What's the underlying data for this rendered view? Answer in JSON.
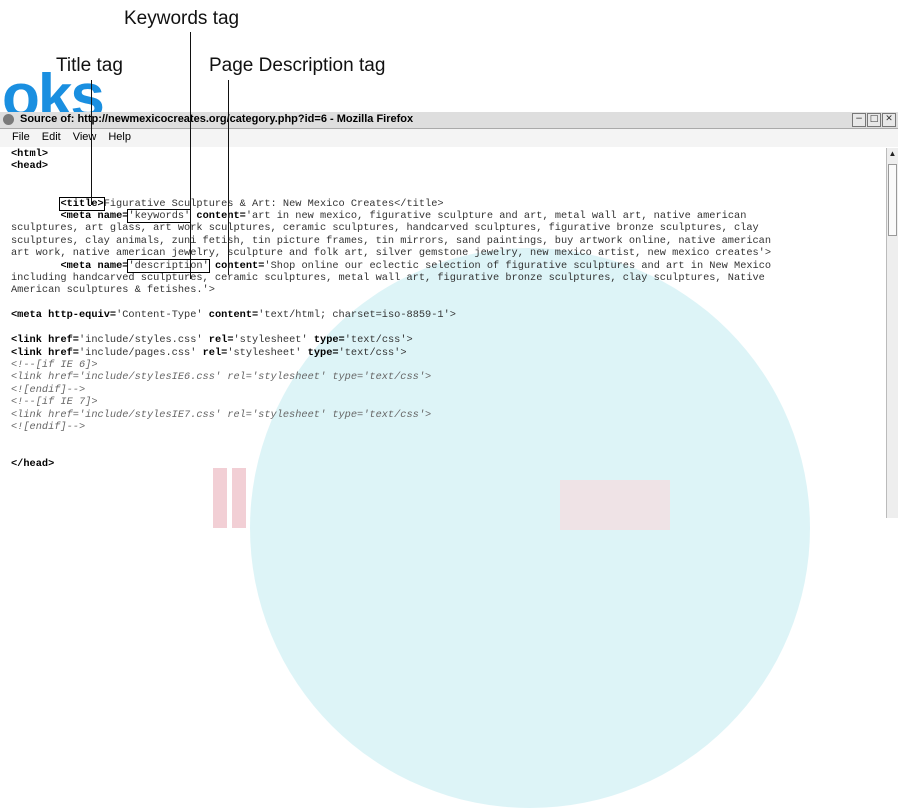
{
  "watermark": {
    "logo_text": "oks"
  },
  "callouts": {
    "keywords_tag": "Keywords tag",
    "title_tag": "Title tag",
    "page_description_tag": "Page Description tag"
  },
  "window": {
    "title": "Source of: http://newmexicocreates.org/category.php?id=6 - Mozilla Firefox",
    "controls": [
      "−",
      "□",
      "✕"
    ]
  },
  "menu": [
    "File",
    "Edit",
    "View",
    "Help"
  ],
  "source": {
    "html_open": "<html>",
    "head_open": "<head>",
    "title_open": "<title>",
    "title_text": "Figurative Sculptures & Art: New Mexico Creates</title>",
    "meta_tag": "<meta",
    "name_attr": "name=",
    "keywords_value": "'keywords'",
    "content_attr": "content=",
    "keywords_content_1": "'art in new mexico, figurative sculpture and art, metal wall art, native american",
    "keywords_content_2": "sculptures, art glass, art work sculptures, ceramic sculptures, handcarved sculptures, figurative bronze sculptures, clay",
    "keywords_content_3": "sculptures, clay animals, zuni fetish, tin picture frames, tin mirrors, sand paintings, buy artwork online, native american",
    "keywords_content_4": "art work, native american jewelry, sculpture and folk art, silver gemstone jewelry, new mexico artist, new mexico creates'>",
    "description_value": "'description'",
    "description_content_1": "'Shop online our eclectic selection of figurative sculptures and art in New Mexico",
    "description_content_2": "including handcarved sculptures, ceramic sculptures, metal wall art, figurative bronze sculptures, clay sculptures, Native",
    "description_content_3": "American sculptures & fetishes.'>",
    "http_equiv_attr": "http-equiv=",
    "http_equiv_value": "'Content-Type'",
    "http_equiv_content": "'text/html; charset=iso-8859-1'>",
    "link_tag": "<link",
    "href_attr": "href=",
    "rel_attr": "rel=",
    "type_attr": "type=",
    "styles_href": "'include/styles.css'",
    "pages_href": "'include/pages.css'",
    "rel_value": "'stylesheet'",
    "type_value": "'text/css'>",
    "comment_if_ie6": "<!--[if IE 6]>",
    "comment_link_ie6": "<link href='include/stylesIE6.css' rel='stylesheet' type='text/css'>",
    "comment_endif_1": "<![endif]-->",
    "comment_if_ie7": "<!--[if IE 7]>",
    "comment_link_ie7": "<link href='include/stylesIE7.css' rel='stylesheet' type='text/css'>",
    "comment_endif_2": "<![endif]-->",
    "head_close": "</head>"
  },
  "colors": {
    "watermark_blue": "#1a8fe0",
    "watermark_circle": "#d2f0f4",
    "titlebar": "#dedede"
  }
}
